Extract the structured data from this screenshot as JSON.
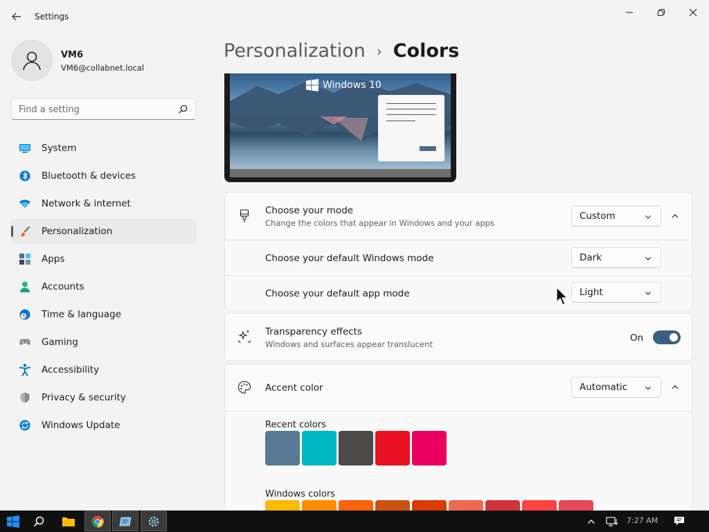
{
  "titlebar": {
    "app_title": "Settings"
  },
  "profile": {
    "name": "VM6",
    "email": "VM6@collabnet.local"
  },
  "search": {
    "placeholder": "Find a setting"
  },
  "nav": {
    "items": [
      {
        "label": "System",
        "icon": "system-icon"
      },
      {
        "label": "Bluetooth & devices",
        "icon": "bluetooth-icon"
      },
      {
        "label": "Network & internet",
        "icon": "wifi-icon"
      },
      {
        "label": "Personalization",
        "icon": "brush-icon",
        "active": true
      },
      {
        "label": "Apps",
        "icon": "apps-icon"
      },
      {
        "label": "Accounts",
        "icon": "accounts-icon"
      },
      {
        "label": "Time & language",
        "icon": "clock-globe-icon"
      },
      {
        "label": "Gaming",
        "icon": "gamepad-icon"
      },
      {
        "label": "Accessibility",
        "icon": "accessibility-icon"
      },
      {
        "label": "Privacy & security",
        "icon": "shield-icon"
      },
      {
        "label": "Windows Update",
        "icon": "update-icon"
      }
    ]
  },
  "breadcrumb": {
    "parent": "Personalization",
    "separator": "›",
    "current": "Colors"
  },
  "preview": {
    "logo_text": "Windows 10"
  },
  "mode_card": {
    "title": "Choose your mode",
    "subtitle": "Change the colors that appear in Windows and your apps",
    "value": "Custom",
    "windows_mode_label": "Choose your default Windows mode",
    "windows_mode_value": "Dark",
    "app_mode_label": "Choose your default app mode",
    "app_mode_value": "Light"
  },
  "transparency_card": {
    "title": "Transparency effects",
    "subtitle": "Windows and surfaces appear translucent",
    "state_label": "On",
    "enabled": true
  },
  "accent_card": {
    "title": "Accent color",
    "value": "Automatic",
    "recent_label": "Recent colors",
    "recent_colors": [
      "#587a94",
      "#00b7c3",
      "#4c4a48",
      "#e81123",
      "#ea005e"
    ],
    "windows_label": "Windows colors",
    "windows_colors": [
      "#ffb900",
      "#ff8c00",
      "#f7630c",
      "#ca5010",
      "#da3b01",
      "#ef6950",
      "#d13438",
      "#ff4343",
      "#e74856"
    ]
  },
  "taskbar": {
    "time": "7:27 AM"
  },
  "colors": {
    "accent": "#3a5f82",
    "background": "#f3f3f3",
    "taskbar": "#101010"
  }
}
